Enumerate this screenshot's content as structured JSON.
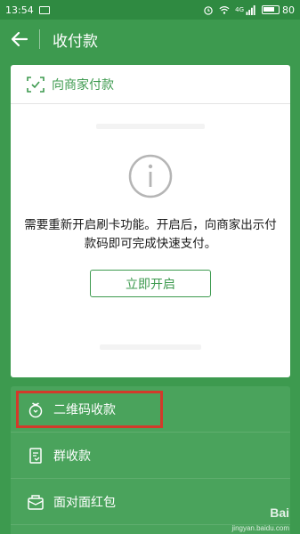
{
  "status_bar": {
    "time": "13:54",
    "network": "4G",
    "battery": "80"
  },
  "app_bar": {
    "title": "收付款"
  },
  "pay_card": {
    "header_label": "向商家付款",
    "notice": "需要重新开启刷卡功能。开启后，向商家出示付款码即可完成快速支付。",
    "enable_button": "立即开启"
  },
  "menu": {
    "items": [
      {
        "label": "二维码收款",
        "icon": "qr-pouch-icon",
        "highlighted": true
      },
      {
        "label": "群收款",
        "icon": "group-bill-icon",
        "highlighted": false
      },
      {
        "label": "面对面红包",
        "icon": "red-packet-icon",
        "highlighted": false
      }
    ]
  },
  "watermark": {
    "brand": "Bai",
    "site": "jingyan.baidu.com"
  },
  "colors": {
    "primary_green": "#3d9a4f",
    "status_green": "#2f8a41",
    "menu_green": "#4aa35c",
    "highlight_red": "#d23a2a"
  }
}
